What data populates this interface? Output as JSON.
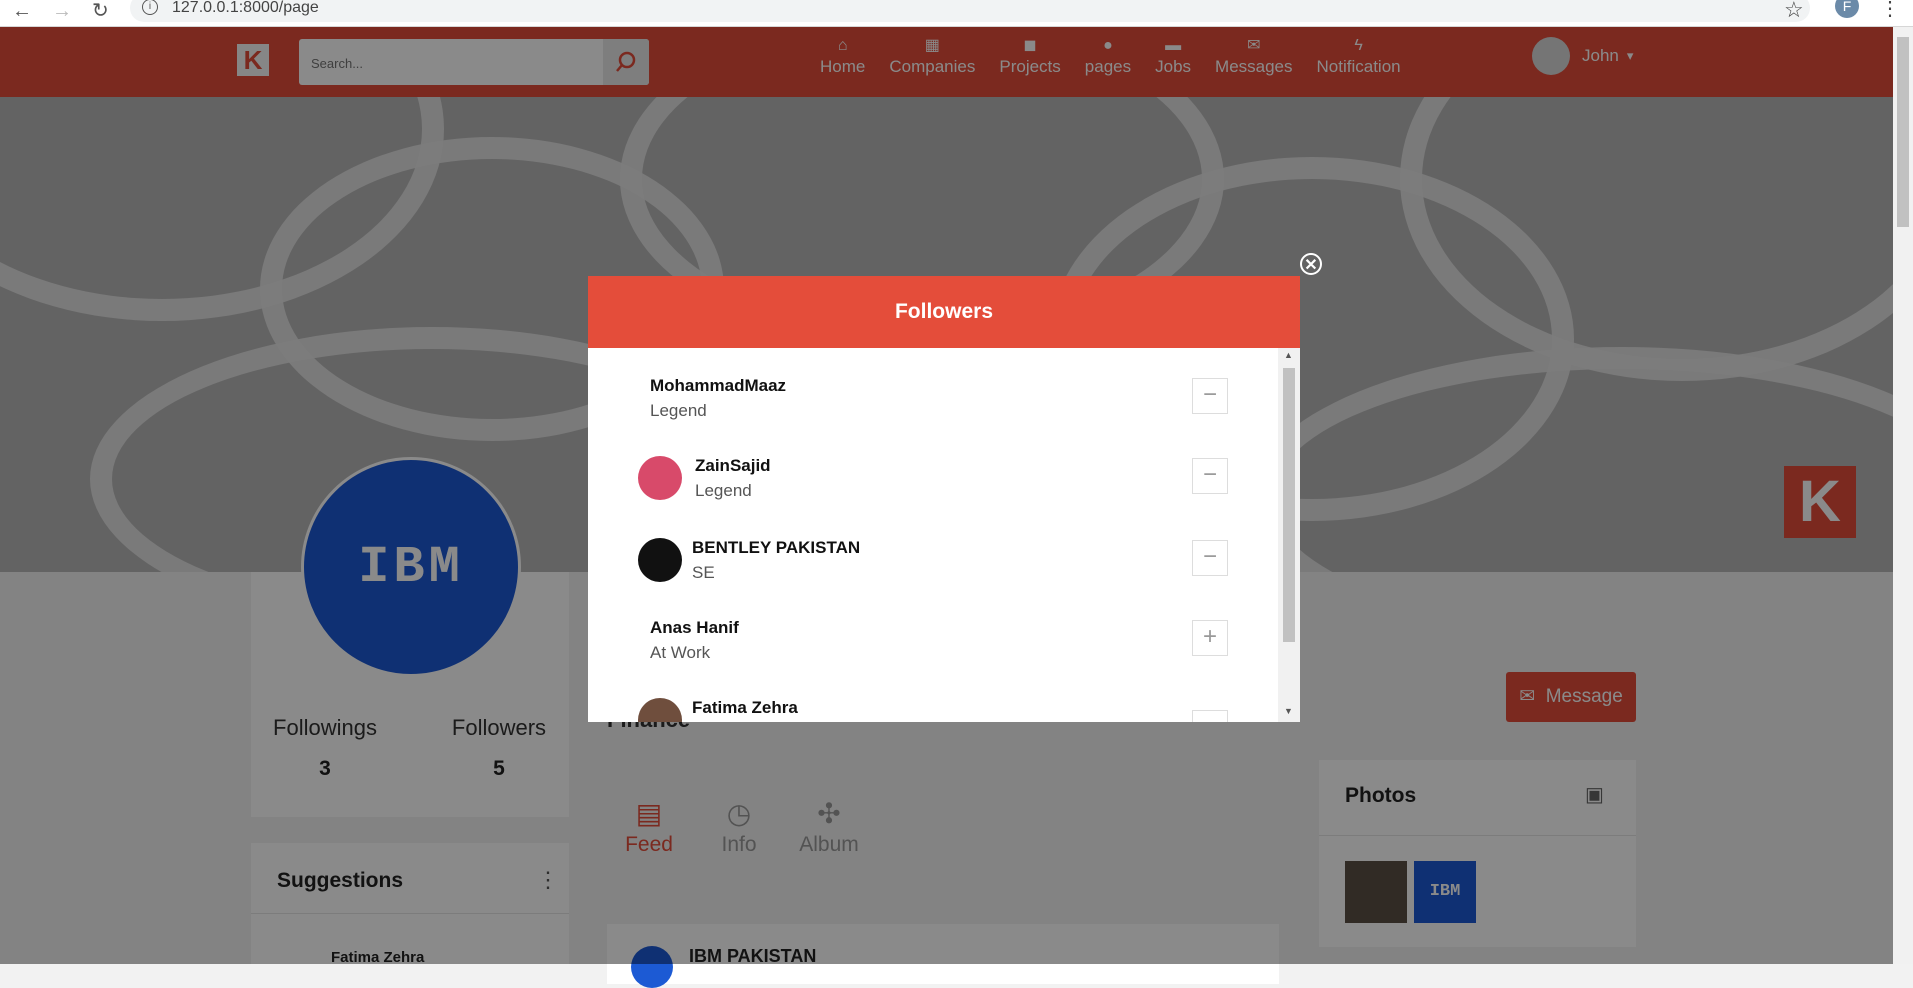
{
  "browser": {
    "url": "127.0.0.1:8000/page",
    "profile_initial": "F"
  },
  "header": {
    "logo": "K",
    "search_placeholder": "Search...",
    "nav": [
      {
        "label": "Home",
        "icon": "home-icon"
      },
      {
        "label": "Companies",
        "icon": "building-icon"
      },
      {
        "label": "Projects",
        "icon": "puzzle-icon"
      },
      {
        "label": "pages",
        "icon": "users-icon"
      },
      {
        "label": "Jobs",
        "icon": "briefcase-icon"
      },
      {
        "label": "Messages",
        "icon": "envelope-icon"
      },
      {
        "label": "Notification",
        "icon": "bolt-icon"
      }
    ],
    "user_name": "John"
  },
  "profile": {
    "logo_text": "IBM",
    "followings_label": "Followings",
    "followings_count": "3",
    "followers_label": "Followers",
    "followers_count": "5",
    "company_category": "Finance"
  },
  "suggestions": {
    "title": "Suggestions",
    "first_name": "Fatima Zehra"
  },
  "tabs": [
    {
      "label": "Feed",
      "icon": "feed-icon",
      "active": true
    },
    {
      "label": "Info",
      "icon": "clock-icon",
      "active": false
    },
    {
      "label": "Album",
      "icon": "puzzle-icon",
      "active": false
    }
  ],
  "post": {
    "author": "IBM PAKISTAN"
  },
  "message_button": "Message",
  "photos": {
    "title": "Photos",
    "thumb2_text": "IBM"
  },
  "modal": {
    "title": "Followers",
    "followers": [
      {
        "name": "MohammadMaaz",
        "subtitle": "Legend",
        "action": "−",
        "has_avatar": false
      },
      {
        "name": "ZainSajid",
        "subtitle": "Legend",
        "action": "−",
        "has_avatar": true
      },
      {
        "name": "BENTLEY PAKISTAN",
        "subtitle": "SE",
        "action": "−",
        "has_avatar": true
      },
      {
        "name": "Anas Hanif",
        "subtitle": "At Work",
        "action": "+",
        "has_avatar": false
      },
      {
        "name": "Fatima Zehra",
        "subtitle": "",
        "action": "",
        "has_avatar": true
      }
    ]
  },
  "colors": {
    "brand": "#e44d3a",
    "ibm_blue": "#1c5ad4"
  }
}
